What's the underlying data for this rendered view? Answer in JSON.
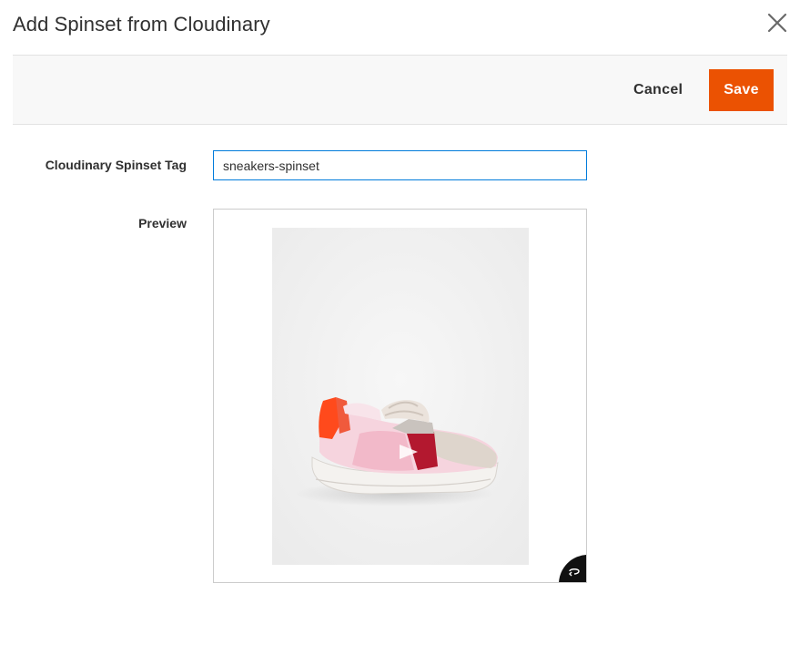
{
  "modal": {
    "title": "Add Spinset from Cloudinary",
    "close_icon": "close-icon"
  },
  "toolbar": {
    "cancel_label": "Cancel",
    "save_label": "Save",
    "save_color": "#eb5202"
  },
  "form": {
    "tag_label": "Cloudinary Spinset Tag",
    "tag_value": "sneakers-spinset",
    "preview_label": "Preview",
    "preview_icon": "spin-360-icon"
  },
  "colors": {
    "accent": "#eb5202",
    "focus_border": "#007bdb"
  }
}
